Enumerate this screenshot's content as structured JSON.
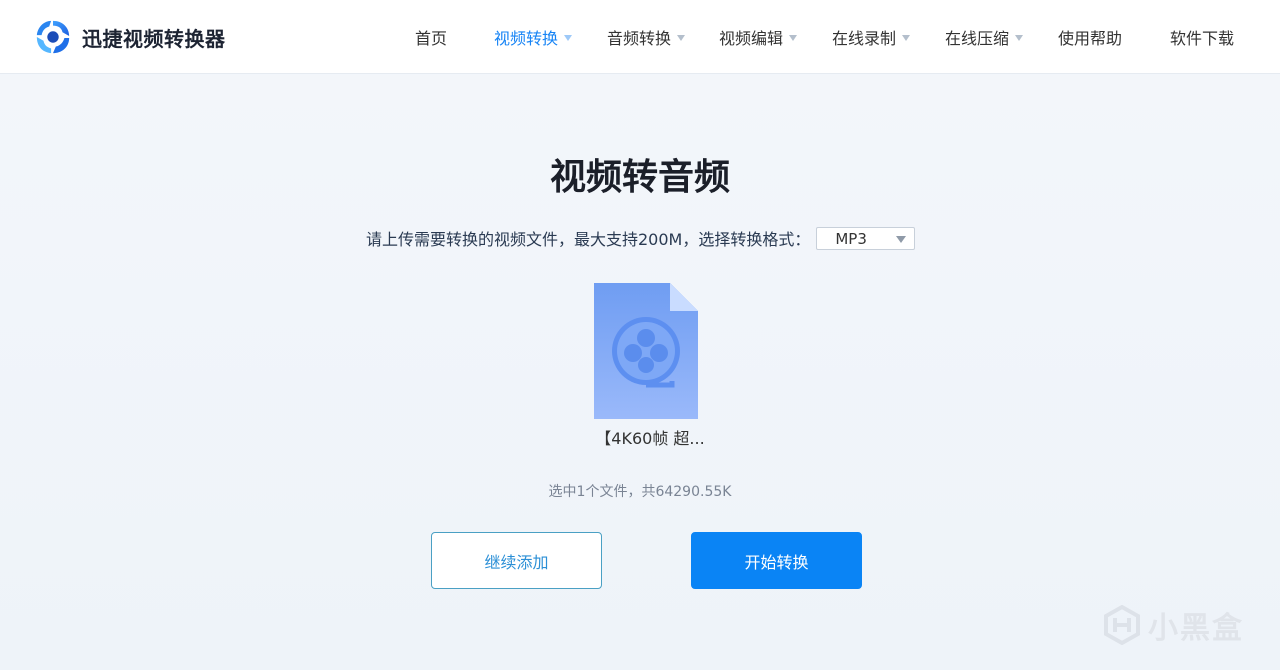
{
  "header": {
    "brand": "迅捷视频转换器",
    "nav": [
      {
        "label": "首页",
        "dropdown": false,
        "active": false
      },
      {
        "label": "视频转换",
        "dropdown": true,
        "active": true
      },
      {
        "label": "音频转换",
        "dropdown": true,
        "active": false
      },
      {
        "label": "视频编辑",
        "dropdown": true,
        "active": false
      },
      {
        "label": "在线录制",
        "dropdown": true,
        "active": false
      },
      {
        "label": "在线压缩",
        "dropdown": true,
        "active": false
      },
      {
        "label": "使用帮助",
        "dropdown": false,
        "active": false
      },
      {
        "label": "软件下载",
        "dropdown": false,
        "active": false
      }
    ]
  },
  "main": {
    "title": "视频转音频",
    "hint": "请上传需要转换的视频文件，最大支持200M，选择转换格式：",
    "format_value": "MP3",
    "file_name": "【4K60帧 超...",
    "summary": "选中1个文件，共64290.55K",
    "add_button": "继续添加",
    "start_button": "开始转换"
  },
  "watermark": {
    "text": "小黑盒"
  },
  "colors": {
    "accent": "#0a84f5",
    "nav_active": "#1784f5",
    "file_icon": "#7aa6f4"
  }
}
